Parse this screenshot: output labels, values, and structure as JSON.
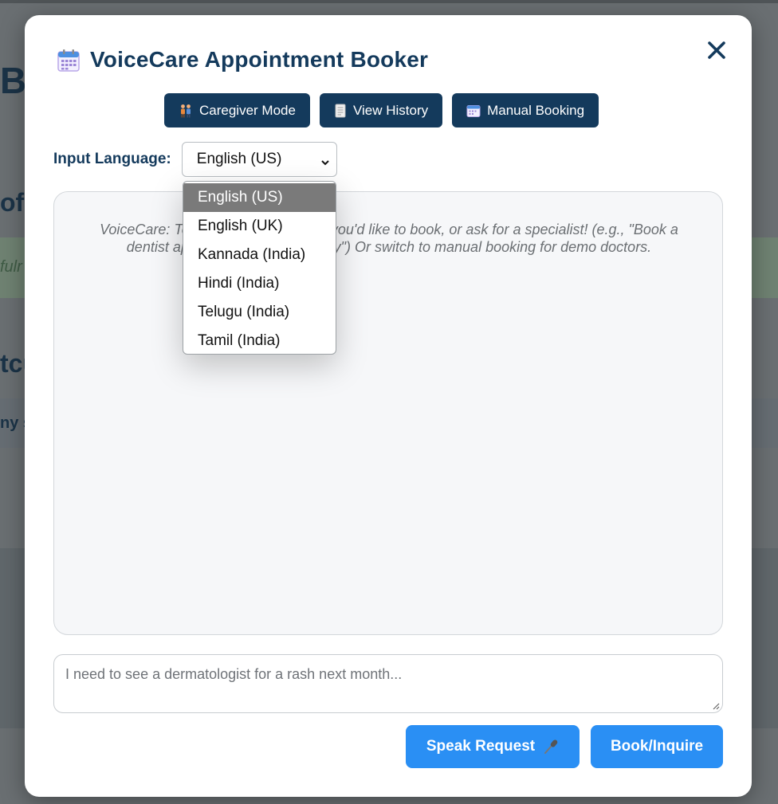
{
  "background": {
    "fragments": [
      "Ba",
      "of",
      "fulr",
      "tcu",
      "ny s"
    ]
  },
  "modal": {
    "title": "VoiceCare Appointment Booker",
    "icon": "calendar-icon",
    "close_label": "✕",
    "mode_buttons": [
      {
        "label": "Caregiver Mode",
        "icon": "people-icon"
      },
      {
        "label": "View History",
        "icon": "document-icon"
      },
      {
        "label": "Manual Booking",
        "icon": "calendar-icon"
      }
    ],
    "language": {
      "label": "Input Language:",
      "selected": "English (US)",
      "options": [
        "English (US)",
        "English (UK)",
        "Kannada (India)",
        "Hindi (India)",
        "Telugu (India)",
        "Tamil (India)"
      ]
    },
    "chat": {
      "welcome": "VoiceCare: Tell me the appointment you'd like to book, or ask for a specialist! (e.g., \"Book a dentist appointment next Tuesday\") Or switch to manual booking for demo doctors."
    },
    "input": {
      "placeholder": "I need to see a dermatologist for a rash next month..."
    },
    "speak_label": "Speak Request",
    "book_label": "Book/Inquire"
  },
  "colors": {
    "primary_dark": "#143a5c",
    "accent_blue": "#2a8ff4",
    "selected_option": "#7a7a7a"
  }
}
